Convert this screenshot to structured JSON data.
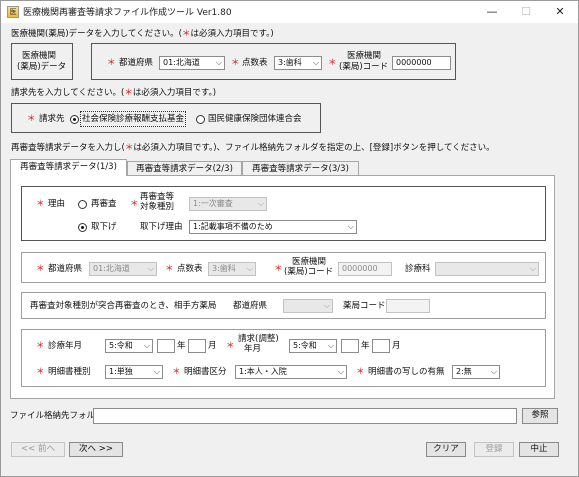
{
  "window": {
    "title": "医療機関再審査等請求ファイル作成ツール Ver1.80",
    "icon": "app-icon",
    "minimize": "—",
    "maximize": "☐",
    "close": "✕"
  },
  "marks": {
    "req": "＊"
  },
  "section1": {
    "instruction_pre": "医療機関(薬局)データを入力してください。(",
    "instruction_post": "は必須入力項目です。)",
    "label_line1": "医療機関",
    "label_line2": "(薬局)データ",
    "pref_label": "都道府県",
    "pref_value": "01:北海道",
    "score_label": "点数表",
    "score_value": "3:歯科",
    "code_label_line1": "医療機関",
    "code_label_line2": "(薬局)コード",
    "code_value": "0000000"
  },
  "section2": {
    "instruction_pre": "請求先を入力してください。(",
    "instruction_post": "は必須入力項目です。)",
    "label": "請求先",
    "options": [
      "社会保険診療報酬支払基金",
      "国民健康保険団体連合会"
    ],
    "selected_index": 0
  },
  "section3": {
    "instruction_pre": "再審査等請求データを入力し(",
    "instruction_post": "は必須入力項目です。)、ファイル格納先フォルダを指定の上、[登録]ボタンを押してください。"
  },
  "tabs": [
    "再審査等請求データ(1/3)",
    "再審査等請求データ(2/3)",
    "再審査等請求データ(3/3)"
  ],
  "reason": {
    "label": "理由",
    "opt_review": "再審査",
    "type_label_line1": "再審査等",
    "type_label_line2": "対象種別",
    "type_value": "1:一次審査",
    "opt_withdraw": "取下げ",
    "withdraw_reason_label": "取下げ理由",
    "withdraw_reason_value": "1:記載事項不備のため",
    "selected": "withdraw"
  },
  "row2": {
    "pref_label": "都道府県",
    "pref_value": "01:北海道",
    "score_label": "点数表",
    "score_value": "3:歯科",
    "code_label_line1": "医療機関",
    "code_label_line2": "(薬局)コード",
    "code_value": "0000000",
    "dept_label": "診療科",
    "dept_value": ""
  },
  "pharmacy": {
    "label": "再審査対象種別が突合再審査のとき、相手方薬局",
    "pref_label": "都道府県",
    "pref_value": "",
    "code_label": "薬局コード",
    "code_value": ""
  },
  "details": {
    "treat_label": "診療年月",
    "treat_era": "5:令和",
    "year_unit": "年",
    "month_unit": "月",
    "treat_year": "",
    "treat_month": "",
    "claim_label_line1": "請求(調整)",
    "claim_label_line2": "年月",
    "claim_era": "5:令和",
    "claim_year": "",
    "claim_month": "",
    "type_label": "明細書種別",
    "type_value": "1:単独",
    "class_label": "明細書区分",
    "class_value": "1:本人・入院",
    "copy_label": "明細書の写しの有無",
    "copy_value": "2:無"
  },
  "folder": {
    "label": "ファイル格納先フォルダ",
    "value": "",
    "browse": "参照"
  },
  "footer": {
    "prev": "<< 前へ",
    "next": "次へ >>",
    "clear": "クリア",
    "register": "登録",
    "abort": "中止"
  }
}
